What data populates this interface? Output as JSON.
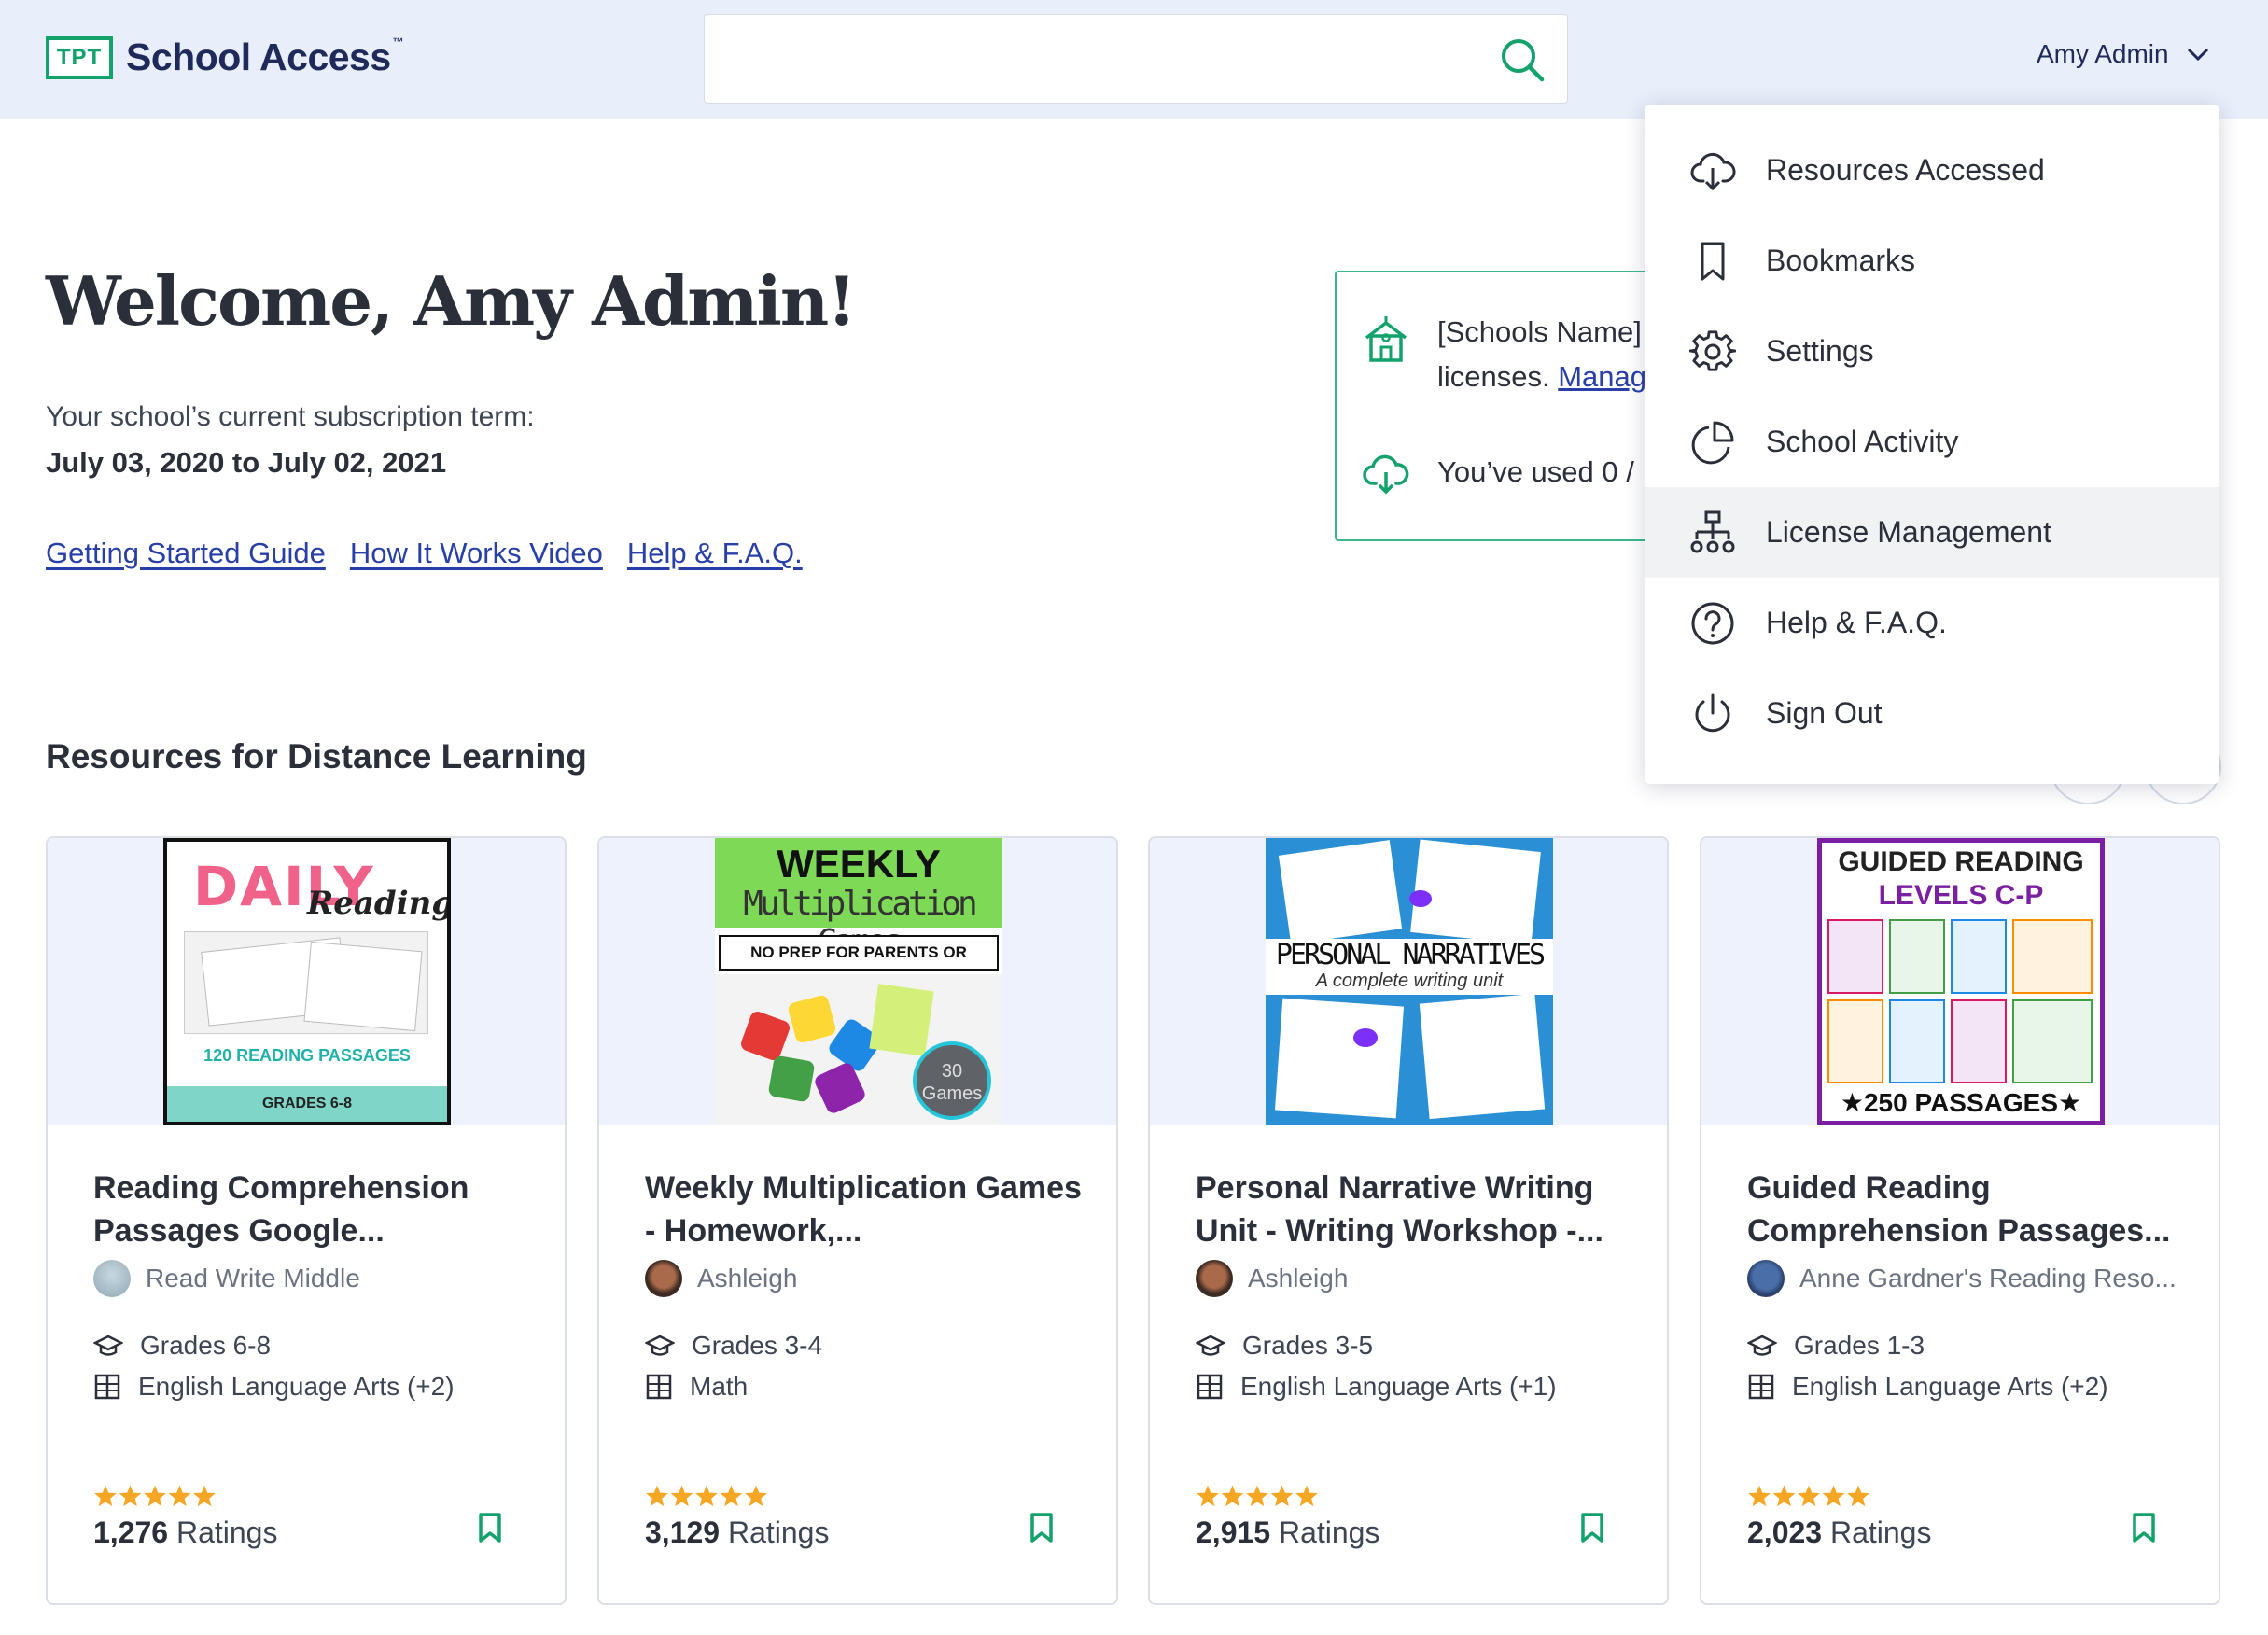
{
  "header": {
    "logo_badge": "TPT",
    "logo_text": "School Access",
    "logo_tm": "™",
    "search_placeholder": "",
    "user_name": "Amy Admin"
  },
  "welcome": {
    "heading": "Welcome, Amy Admin!",
    "term_label": "Your school’s current subscription term:",
    "term_dates": "July 03, 2020 to July 02, 2021",
    "links": [
      "Getting Started Guide",
      "How It Works Video",
      "Help & F.A.Q."
    ]
  },
  "license_box": {
    "line1": "[Schools Name]",
    "line2_prefix": "licenses. ",
    "line2_link": "Manag",
    "line3": "You’ve used 0 /"
  },
  "section": {
    "title": "Resources for Distance Learning"
  },
  "cards": [
    {
      "title": "Reading Comprehension Passages Google...",
      "author": "Read Write Middle",
      "grades": "Grades 6-8",
      "subject": "English Language Arts (+2)",
      "rating": 5,
      "ratings_count": "1,276",
      "ratings_label": " Ratings",
      "thumb": {
        "line1": "DAILY",
        "line2": "Reading",
        "line3": "120 READING PASSAGES",
        "line4": "GRADES 6-8"
      }
    },
    {
      "title": "Weekly Multiplication Games - Homework,...",
      "author": "Ashleigh",
      "grades": "Grades 3-4",
      "subject": "Math",
      "rating": 5,
      "ratings_count": "3,129",
      "ratings_label": " Ratings",
      "thumb": {
        "line1": "WEEKLY",
        "line2": "Multiplication Games",
        "line3": "NO PREP FOR PARENTS OR TEACHERS",
        "line4": "30 Games"
      }
    },
    {
      "title": "Personal Narrative Writing Unit - Writing Workshop -...",
      "author": "Ashleigh",
      "grades": "Grades 3-5",
      "subject": "English Language Arts (+1)",
      "rating": 5,
      "ratings_count": "2,915",
      "ratings_label": " Ratings",
      "thumb": {
        "line1": "PERSONAL NARRATIVES",
        "line2": "A complete writing unit"
      }
    },
    {
      "title": "Guided Reading Comprehension Passages...",
      "author": "Anne Gardner's Reading Reso...",
      "grades": "Grades 1-3",
      "subject": "English Language Arts (+2)",
      "rating": 5,
      "ratings_count": "2,023",
      "ratings_label": " Ratings",
      "thumb": {
        "line1": "GUIDED READING",
        "line2": "LEVELS C-P",
        "line3": "★250 PASSAGES★"
      }
    }
  ],
  "menu": {
    "items": [
      {
        "label": "Resources Accessed",
        "icon": "cloud-download-icon"
      },
      {
        "label": "Bookmarks",
        "icon": "bookmark-icon"
      },
      {
        "label": "Settings",
        "icon": "gear-icon"
      },
      {
        "label": "School Activity",
        "icon": "pie-chart-icon"
      },
      {
        "label": "License Management",
        "icon": "org-chart-icon",
        "active": true
      },
      {
        "label": "Help & F.A.Q.",
        "icon": "question-circle-icon"
      },
      {
        "label": "Sign Out",
        "icon": "power-icon"
      }
    ]
  },
  "colors": {
    "brand_green": "#13a26b",
    "brand_navy": "#1f2a5a",
    "link_blue": "#283fa8",
    "header_bg": "#e8eefa",
    "star": "#f5a623"
  }
}
